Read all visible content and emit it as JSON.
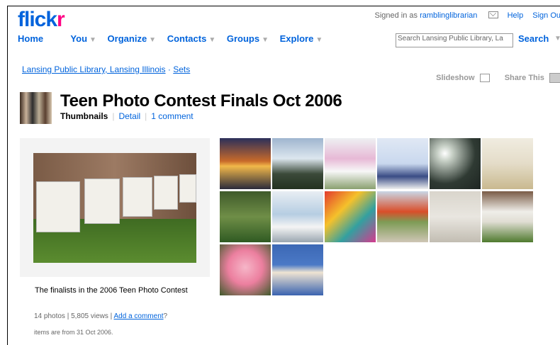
{
  "header": {
    "logo_blue": "flick",
    "logo_pink": "r",
    "signed_in_prefix": "Signed in as",
    "username": "ramblinglibrarian",
    "help": "Help",
    "sign_out": "Sign Ou"
  },
  "nav": {
    "items": [
      "Home",
      "You",
      "Organize",
      "Contacts",
      "Groups",
      "Explore"
    ],
    "search_placeholder": "Search Lansing Public Library, La",
    "search_button": "Search"
  },
  "breadcrumb": {
    "owner": "Lansing Public Library, Lansing Illinois",
    "sep": "·",
    "sets": "Sets"
  },
  "tools": {
    "slideshow": "Slideshow",
    "share": "Share This"
  },
  "set": {
    "title": "Teen Photo Contest Finals Oct 2006",
    "tab_thumbnails": "Thumbnails",
    "tab_detail": "Detail",
    "comments": "1 comment",
    "description": "The finalists in the 2006 Teen Photo Contest",
    "stats_prefix": "14 photos | 5,805 views |",
    "add_comment": "Add a comment",
    "stats_suffix": "?",
    "dates": "items are from 31 Oct 2006."
  },
  "thumbnails": [
    {
      "name": "sunset-lake",
      "bg": "linear-gradient(180deg,#2b2f5a 0,#c86a2a 45%,#f2b84a 55%,#2a2a3a 100%)"
    },
    {
      "name": "backyard-trees",
      "bg": "linear-gradient(180deg,#9fb5cf 0,#dce6ee 40%,#3b4a3a 70%,#24321f 100%)"
    },
    {
      "name": "pink-tulips",
      "bg": "linear-gradient(180deg,#eef0f2 0,#e7b9d6 40%,#f7f7f7 65%,#8aa070 100%)"
    },
    {
      "name": "girl-portrait",
      "bg": "linear-gradient(180deg,#e0e8f4 0,#c9d8ee 50%,#3a4c85 75%,#f0f0f0 100%)"
    },
    {
      "name": "sun-through-trees",
      "bg": "radial-gradient(circle at 30% 30%,#fff 0,#c7d0c6 15%,#2f3a33 60%,#1e2522 100%)"
    },
    {
      "name": "teddy-bear",
      "bg": "linear-gradient(180deg,#f0ece0 0,#e4dcc8 50%,#c9b98f 100%)"
    },
    {
      "name": "tree-lawn",
      "bg": "linear-gradient(180deg,#3f5a2a 0,#6f8e47 50%,#2f5a22 100%)"
    },
    {
      "name": "mugs-shelf",
      "bg": "linear-gradient(180deg,#e8eef3 0,#b6cde2 45%,#f4f4f4 70%,#9aa6b0 100%)"
    },
    {
      "name": "colorful-sculpture",
      "bg": "linear-gradient(135deg,#e33b2e 0,#f5c12b 35%,#33a0a0 65%,#d63a8e 100%)"
    },
    {
      "name": "red-tree",
      "bg": "linear-gradient(180deg,#c9d7e6 0,#d94e2a 40%,#7e9b55 60%,#cfc6b6 100%)"
    },
    {
      "name": "sand-tracks",
      "bg": "linear-gradient(180deg,#d9d5cc 0,#e9e6e0 50%,#c2bdb2 100%)"
    },
    {
      "name": "gas-meters-small",
      "bg": "linear-gradient(180deg,#7a5b46 0,#efeee9 40%,#e0ddd3 60%,#4f7a2e 100%)"
    },
    {
      "name": "pink-hydrangea",
      "bg": "radial-gradient(circle at 50% 45%,#f6b6c8 0,#ec7f9f 45%,#3e5a2a 100%)"
    },
    {
      "name": "puppies",
      "bg": "linear-gradient(180deg,#3c68b5 0,#4b79c6 40%,#efe4d2 55%,#3a63b0 100%)"
    }
  ]
}
